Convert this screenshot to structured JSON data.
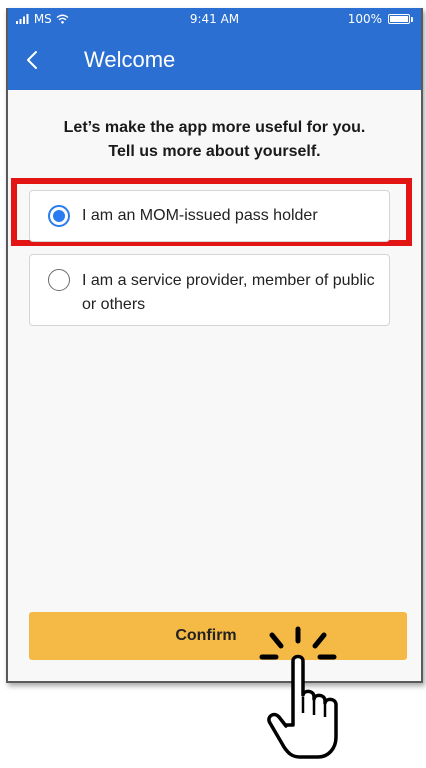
{
  "status_bar": {
    "carrier": "MS",
    "time": "9:41 AM",
    "battery": "100%"
  },
  "nav": {
    "title": "Welcome"
  },
  "prompt": {
    "line1": "Let’s make the app more useful for you.",
    "line2": "Tell us more about yourself."
  },
  "options": [
    {
      "label": "I am an MOM-issued pass holder",
      "selected": true
    },
    {
      "label": "I am a service provider, member of public or others",
      "selected": false
    }
  ],
  "confirm_label": "Confirm",
  "colors": {
    "header": "#2a6fd1",
    "accent": "#2a7cf0",
    "confirm": "#f5b946",
    "highlight": "#e31414"
  },
  "icons": {
    "back": "chevron-left-icon",
    "hand": "tap-hand-icon"
  }
}
